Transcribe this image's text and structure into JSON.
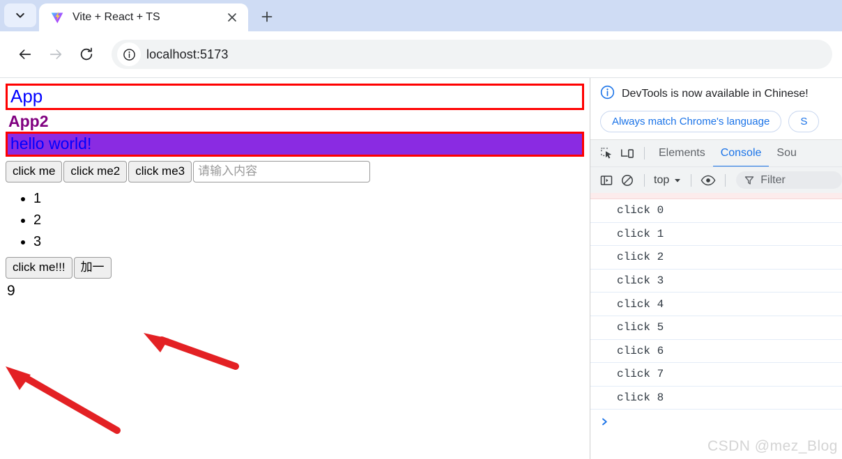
{
  "browser": {
    "tab_list_icon": "chevron-down-icon",
    "tab": {
      "favicon": "vite-logo-icon",
      "title": "Vite + React + TS",
      "close_icon": "close-icon"
    },
    "new_tab_icon": "plus-icon",
    "toolbar": {
      "back_icon": "back-arrow-icon",
      "forward_icon": "forward-arrow-icon",
      "reload_icon": "reload-icon",
      "site_info_icon": "info-circle-icon",
      "url": "localhost:5173"
    }
  },
  "page": {
    "app_heading": "App",
    "app2_heading": "App2",
    "hello_text": "hello world!",
    "buttons": [
      {
        "label": "click me"
      },
      {
        "label": "click me2"
      },
      {
        "label": "click me3"
      }
    ],
    "input_placeholder": "请输入内容",
    "input_value": "",
    "list_items": [
      "1",
      "2",
      "3"
    ],
    "counter_buttons": [
      {
        "label": "click me!!!"
      },
      {
        "label": "加一"
      }
    ],
    "counter_value": "9",
    "colors": {
      "annotation_border": "#ff0000",
      "hello_background": "#8a2be2",
      "hello_text": "#0000ff",
      "app_heading": "#0000ff",
      "app2_heading": "#800080",
      "arrow": "#e32124"
    },
    "annotations": [
      {
        "name": "arrow-to-counter-buttons"
      },
      {
        "name": "arrow-to-counter-value"
      }
    ]
  },
  "devtools": {
    "banner": {
      "info_icon": "info-circle-icon",
      "message": "DevTools is now available in Chinese!",
      "primary_button": "Always match Chrome's language",
      "secondary_button": "S"
    },
    "toolbar": {
      "inspect_icon": "inspect-element-icon",
      "device_icon": "device-toolbar-icon",
      "tabs": [
        {
          "label": "Elements",
          "active": false
        },
        {
          "label": "Console",
          "active": true
        },
        {
          "label": "Sou",
          "active": false
        }
      ]
    },
    "subbar": {
      "sidebar_icon": "console-sidebar-icon",
      "clear_icon": "clear-console-icon",
      "context": "top",
      "context_caret": "caret-down-icon",
      "eye_icon": "live-expression-eye-icon",
      "filter_icon": "filter-funnel-icon",
      "filter_placeholder": "Filter"
    },
    "console_logs": [
      "click 0",
      "click 1",
      "click 2",
      "click 3",
      "click 4",
      "click 5",
      "click 6",
      "click 7",
      "click 8"
    ],
    "prompt_icon": "prompt-chevron-icon",
    "watermark": "CSDN @mez_Blog"
  }
}
